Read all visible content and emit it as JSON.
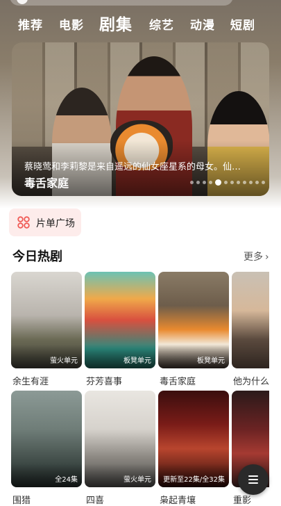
{
  "nav": {
    "tabs": [
      {
        "label": "推荐"
      },
      {
        "label": "电影"
      },
      {
        "label": "剧集",
        "active": true
      },
      {
        "label": "综艺"
      },
      {
        "label": "动漫"
      },
      {
        "label": "短剧"
      }
    ]
  },
  "banner": {
    "caption": "蔡晓莺和李莉黎是来自遥远的仙女座星系的母女。仙…",
    "title": "毒舌家庭",
    "carousel": {
      "total": 12,
      "active_index": 4
    }
  },
  "playlist_button": {
    "label": "片单广场",
    "icon": "flower-grid-icon",
    "accent": "#f05a55"
  },
  "section": {
    "title": "今日热剧",
    "more_label": "更多",
    "more_icon": "chevron-right-icon"
  },
  "shows_row1": [
    {
      "title": "余生有涯",
      "badge": "萤火单元"
    },
    {
      "title": "芬芳喜事",
      "badge": "板凳单元"
    },
    {
      "title": "毒舌家庭",
      "badge": "板凳单元"
    },
    {
      "title": "他为什么",
      "badge": ""
    }
  ],
  "shows_row2": [
    {
      "title": "围猎",
      "badge": "全24集"
    },
    {
      "title": "四喜",
      "badge": "萤火单元"
    },
    {
      "title": "枭起青壤",
      "badge": "更新至22集/全32集"
    },
    {
      "title": "重影",
      "badge": ""
    }
  ],
  "fab": {
    "icon": "menu-icon"
  }
}
